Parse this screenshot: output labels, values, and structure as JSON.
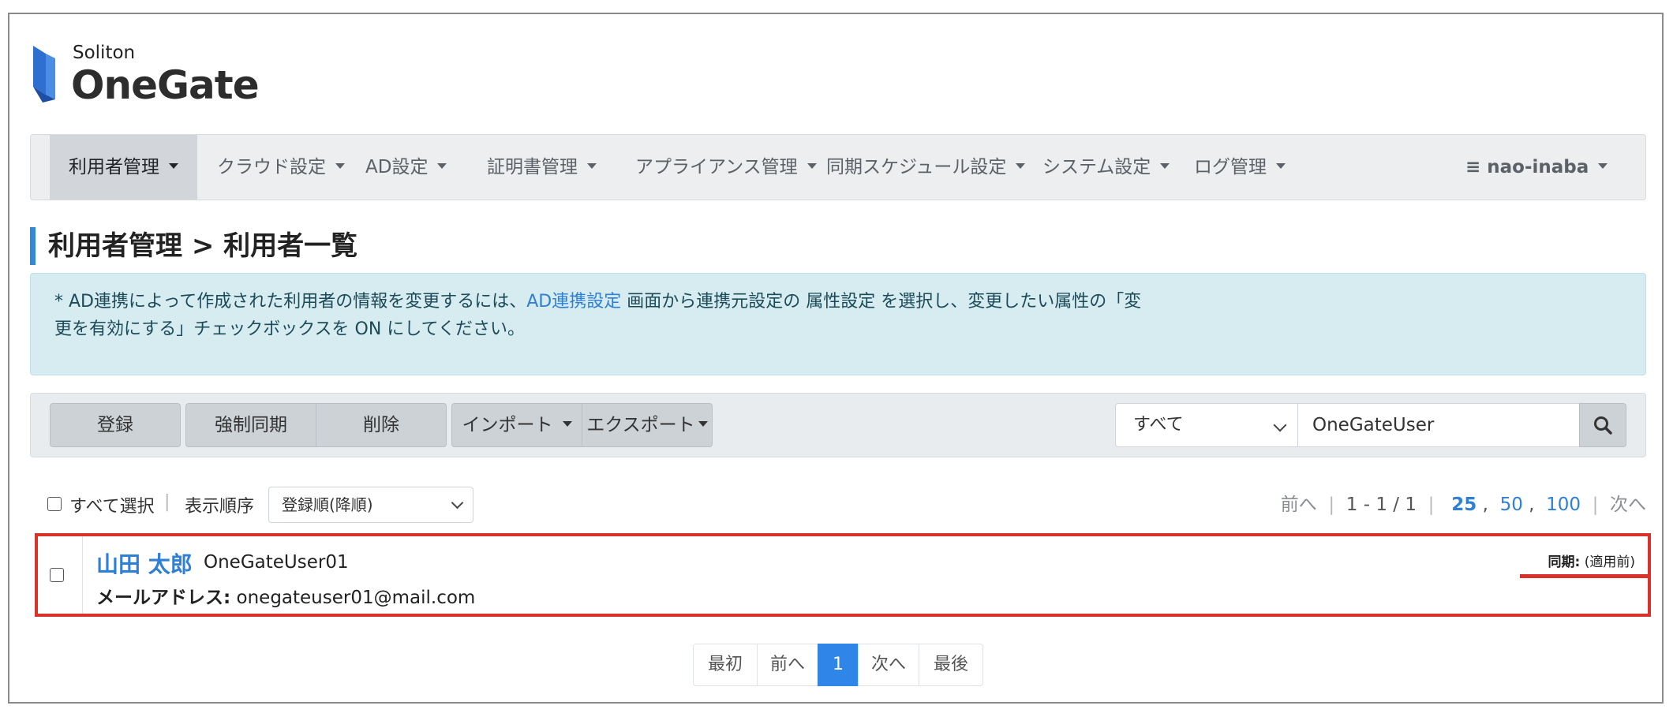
{
  "logo": {
    "top_text": "Soliton",
    "main_text": "OneGate",
    "mark_color": "#2f6fcf"
  },
  "nav": {
    "items": [
      {
        "label": "利用者管理"
      },
      {
        "label": "クラウド設定"
      },
      {
        "label": "AD設定"
      },
      {
        "label": "証明書管理"
      },
      {
        "label": "アプライアンス管理"
      },
      {
        "label": "同期スケジュール設定"
      },
      {
        "label": "システム設定"
      },
      {
        "label": "ログ管理"
      }
    ],
    "active_index": 0,
    "user_label": "≡ nao-inaba"
  },
  "page": {
    "title": "利用者管理 > 利用者一覧"
  },
  "alert": {
    "part1": "* AD連携によって作成された利用者の情報を変更するには、",
    "link": "AD連携設定",
    "part2": " 画面から連携元設定の 属性設定 を選択し、変更したい属性の「変",
    "line2": "更を有効にする」チェックボックスを ON にしてください。"
  },
  "toolbar": {
    "register_label": "登録",
    "force_sync_label": "強制同期",
    "delete_label": "削除",
    "import_label": "インポート",
    "export_label": "エクスポート",
    "filter_value": "すべて",
    "search_value": "OneGateUser"
  },
  "list": {
    "select_all_label": "すべて選択",
    "sort_label": "表示順序",
    "sort_value": "登録順(降順)",
    "prev_label": "前へ",
    "range_label": "1 - 1 / 1",
    "page_sizes": [
      "25",
      "50",
      "100"
    ],
    "next_label": "次へ"
  },
  "users": [
    {
      "name": "山田 太郎",
      "login": "OneGateUser01",
      "email_label": "メールアドレス:",
      "email": "onegateuser01@mail.com",
      "sync_label": "同期:",
      "sync_value": "(適用前)"
    }
  ],
  "pagination": {
    "first": "最初",
    "prev": "前へ",
    "current": "1",
    "next": "次へ",
    "last": "最後"
  },
  "colors": {
    "accent": "#2f7fd4",
    "highlight": "#d9322b",
    "alert_bg": "#d6ecf1"
  }
}
